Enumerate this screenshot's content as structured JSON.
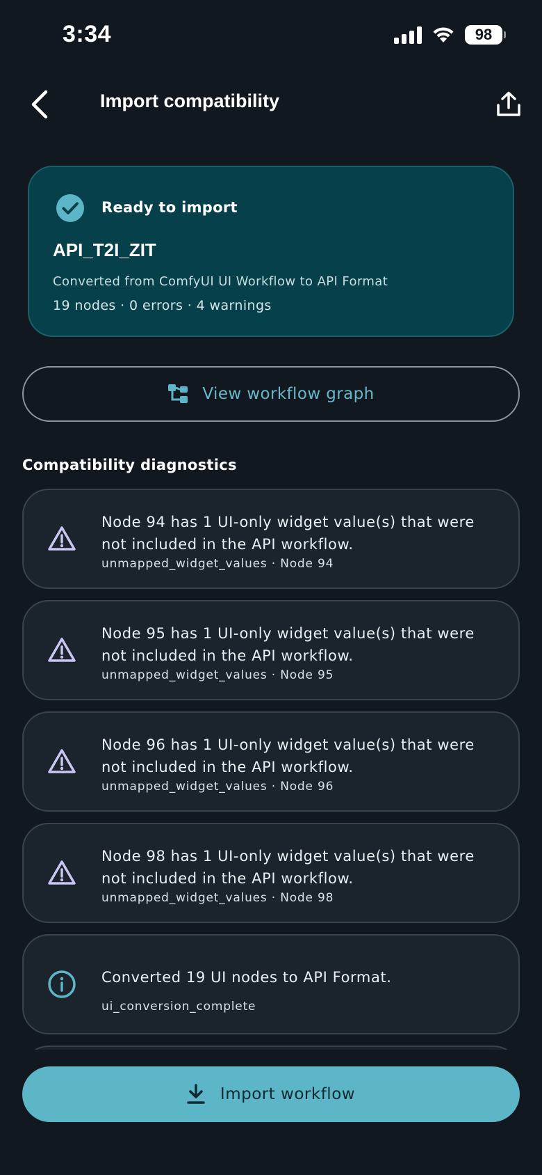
{
  "status_bar": {
    "time": "3:34",
    "battery": "98"
  },
  "header": {
    "title": "Import compatibility"
  },
  "summary": {
    "status": "Ready to import",
    "workflow_name": "API_T2I_ZIT",
    "source": "Converted from ComfyUI UI Workflow to API Format",
    "stats": "19 nodes · 0 errors · 4 warnings"
  },
  "view_graph_button": {
    "label": "View workflow graph"
  },
  "diagnostics": {
    "title": "Compatibility diagnostics",
    "items": [
      {
        "severity": "warning",
        "icon": "warning-icon",
        "message": "Node 94 has 1 UI-only widget value(s) that were not included in the API workflow.",
        "meta": "unmapped_widget_values · Node 94"
      },
      {
        "severity": "warning",
        "icon": "warning-icon",
        "message": "Node 95 has 1 UI-only widget value(s) that were not included in the API workflow.",
        "meta": "unmapped_widget_values · Node 95"
      },
      {
        "severity": "warning",
        "icon": "warning-icon",
        "message": "Node 96 has 1 UI-only widget value(s) that were not included in the API workflow.",
        "meta": "unmapped_widget_values · Node 96"
      },
      {
        "severity": "warning",
        "icon": "warning-icon",
        "message": "Node 98 has 1 UI-only widget value(s) that were not included in the API workflow.",
        "meta": "unmapped_widget_values · Node 98"
      },
      {
        "severity": "info",
        "icon": "info-icon",
        "message": "Converted 19 UI nodes to API Format.",
        "meta": "ui_conversion_complete"
      }
    ]
  },
  "import_button": {
    "label": "Import workflow"
  },
  "colors": {
    "background": "#111820",
    "summary_card": "#06404a",
    "accent": "#5db6c8",
    "warning_icon": "#c9c6f0",
    "info_icon": "#5db6c8"
  }
}
